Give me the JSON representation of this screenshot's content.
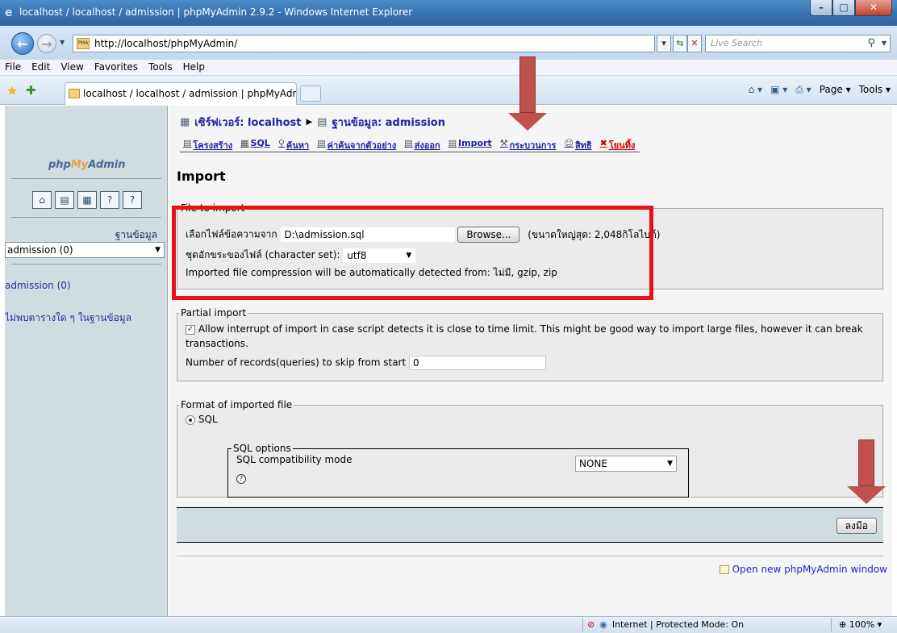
{
  "window": {
    "title": "localhost / localhost / admission | phpMyAdmin 2.9.2 - Windows Internet Explorer"
  },
  "address": {
    "url": "http://localhost/phpMyAdmin/",
    "search_placeholder": "Live Search"
  },
  "menu": [
    "File",
    "Edit",
    "View",
    "Favorites",
    "Tools",
    "Help"
  ],
  "tab": {
    "title": "localhost / localhost / admission | phpMyAdmin ..."
  },
  "commands": {
    "page": "Page",
    "tools": "Tools"
  },
  "sidebar": {
    "logo_php": "php",
    "logo_my": "My",
    "logo_admin": "Admin",
    "db_label": "ฐานข้อมูล",
    "db_select": "admission (0)",
    "db_link": "admission (0)",
    "no_tables": "ไม่พบตารางใด ๆ ในฐานข้อมูล"
  },
  "breadcrumb": {
    "server": "เซิร์ฟเวอร์: localhost",
    "database": "ฐานข้อมูล: admission"
  },
  "tabs": [
    {
      "label": "โครงสร้าง"
    },
    {
      "label": "SQL"
    },
    {
      "label": "ค้นหา"
    },
    {
      "label": "ค่าค้นจากตัวอย่าง"
    },
    {
      "label": "ส่งออก"
    },
    {
      "label": "Import"
    },
    {
      "label": "กระบวนการ"
    },
    {
      "label": "สิทธิ"
    },
    {
      "label": "โยนทิ้ง"
    }
  ],
  "page_title": "Import",
  "file_import": {
    "legend": "File to import",
    "file_label": "เลือกไฟล์ข้อความจาก",
    "file_value": "D:\\admission.sql",
    "browse": "Browse...",
    "max_size": "(ขนาดใหญ่สุด: 2,048กิโลไบต์)",
    "charset_label": "ชุดอักขระของไฟล์ (character set):",
    "charset_value": "utf8",
    "compression_note": "Imported file compression will be automatically detected from: ไม่มี, gzip, zip"
  },
  "partial_import": {
    "legend": "Partial import",
    "allow_interrupt": "Allow interrupt of import in case script detects it is close to time limit. This might be good way to import large files, however it can break",
    "allow_interrupt_2": "transactions.",
    "skip_label": "Number of records(queries) to skip from start",
    "skip_value": "0"
  },
  "format": {
    "legend": "Format of imported file",
    "sql": "SQL",
    "options_legend": "SQL options",
    "compat_label": "SQL compatibility mode",
    "compat_value": "NONE"
  },
  "go_button": "ลงมือ",
  "open_new_window": "Open new phpMyAdmin window",
  "status": {
    "zone": "Internet | Protected Mode: On",
    "zoom": "100%"
  }
}
